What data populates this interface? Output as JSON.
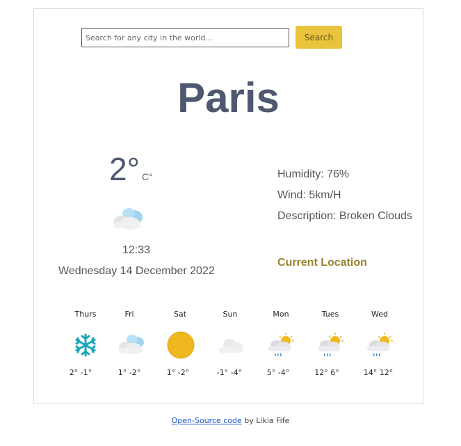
{
  "search": {
    "placeholder": "Search for any city in the world...",
    "button_label": "Search"
  },
  "weather": {
    "city": "Paris",
    "temperature": "2°",
    "unit": "C°",
    "icon": "broken-clouds-icon",
    "time": "12:33",
    "date": "Wednesday 14 December 2022",
    "humidity": "Humidity: 76%",
    "wind": "Wind: 5km/H",
    "description": "Description: Broken Clouds",
    "current_location_label": "Current Location"
  },
  "forecast": [
    {
      "day": "Thurs",
      "temps": "2° -1°",
      "icon": "snow-icon"
    },
    {
      "day": "Fri",
      "temps": "1° -2°",
      "icon": "broken-clouds-icon"
    },
    {
      "day": "Sat",
      "temps": "1° -2°",
      "icon": "sun-icon"
    },
    {
      "day": "Sun",
      "temps": "-1° -4°",
      "icon": "cloud-icon"
    },
    {
      "day": "Mon",
      "temps": "5° -4°",
      "icon": "rain-sun-icon"
    },
    {
      "day": "Tues",
      "temps": "12° 6°",
      "icon": "rain-sun-icon"
    },
    {
      "day": "Wed",
      "temps": "14° 12°",
      "icon": "rain-sun-icon"
    }
  ],
  "footer": {
    "link_text": "Open-Source code",
    "suffix": " by Likia Fife"
  }
}
